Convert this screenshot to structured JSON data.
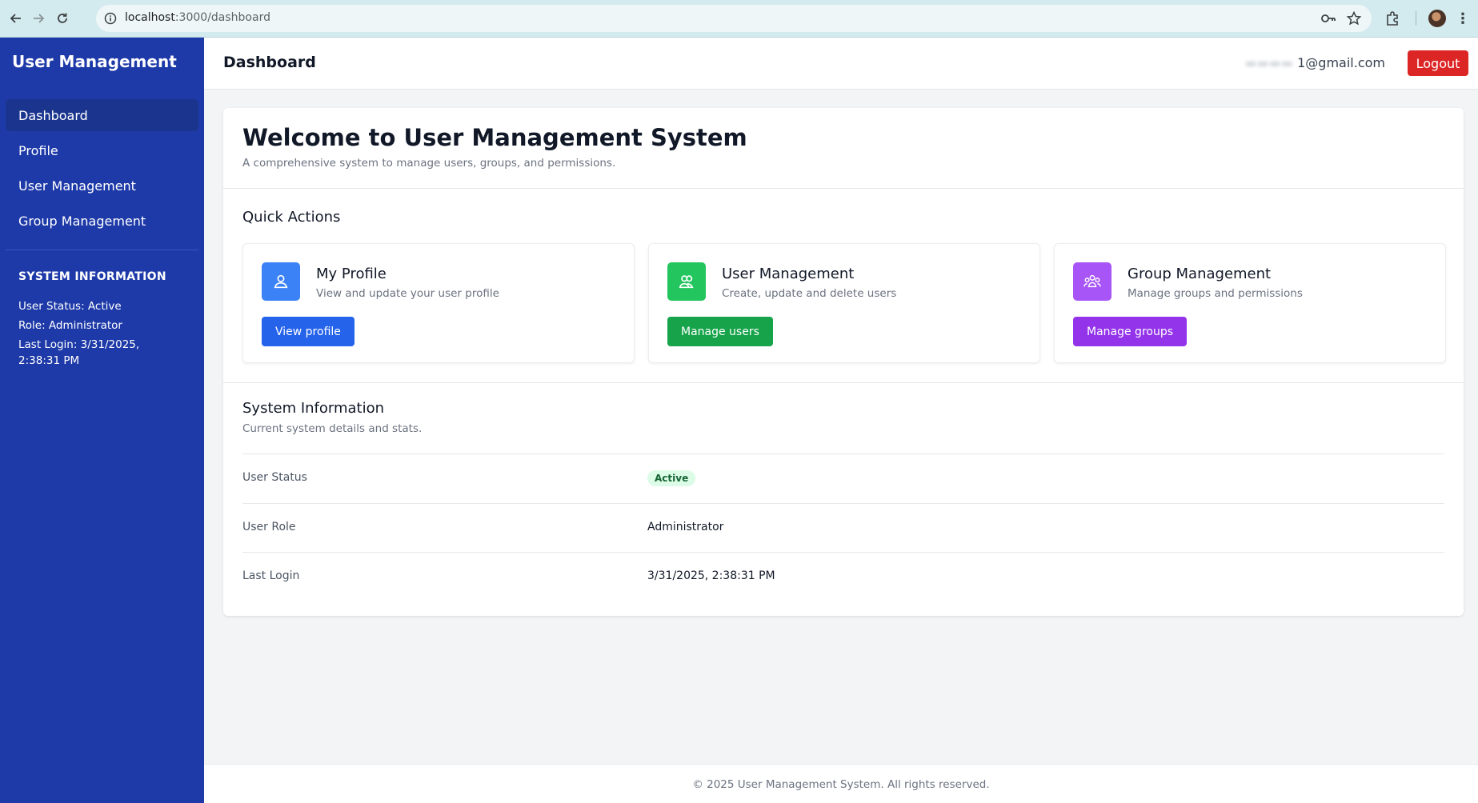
{
  "browser": {
    "url_host": "localhost",
    "url_path": ":3000/dashboard"
  },
  "sidebar": {
    "brand": "User Management",
    "items": [
      {
        "label": "Dashboard",
        "active": true
      },
      {
        "label": "Profile",
        "active": false
      },
      {
        "label": "User Management",
        "active": false
      },
      {
        "label": "Group Management",
        "active": false
      }
    ],
    "info_title": "SYSTEM INFORMATION",
    "info_status": "User Status: Active",
    "info_role": "Role: Administrator",
    "info_last_login": "Last Login: 3/31/2025, 2:38:31 PM"
  },
  "topbar": {
    "title": "Dashboard",
    "email_visible": "1@gmail.com",
    "logout_label": "Logout"
  },
  "main": {
    "welcome_title": "Welcome to User Management System",
    "welcome_subtitle": "A comprehensive system to manage users, groups, and permissions.",
    "quick_actions_title": "Quick Actions",
    "actions": [
      {
        "title": "My Profile",
        "description": "View and update your user profile",
        "button": "View profile",
        "icon": "user-icon",
        "color": "#3b82f6",
        "button_color": "#2563eb"
      },
      {
        "title": "User Management",
        "description": "Create, update and delete users",
        "button": "Manage users",
        "icon": "users-icon",
        "color": "#22c55e",
        "button_color": "#16a34a"
      },
      {
        "title": "Group Management",
        "description": "Manage groups and permissions",
        "button": "Manage groups",
        "icon": "group-icon",
        "color": "#a855f7",
        "button_color": "#9333ea"
      }
    ],
    "system_info_title": "System Information",
    "system_info_subtitle": "Current system details and stats.",
    "rows": [
      {
        "label": "User Status",
        "value": "Active"
      },
      {
        "label": "User Role",
        "value": "Administrator"
      },
      {
        "label": "Last Login",
        "value": "3/31/2025, 2:38:31 PM"
      }
    ]
  },
  "footer": {
    "text": "© 2025 User Management System. All rights reserved."
  }
}
